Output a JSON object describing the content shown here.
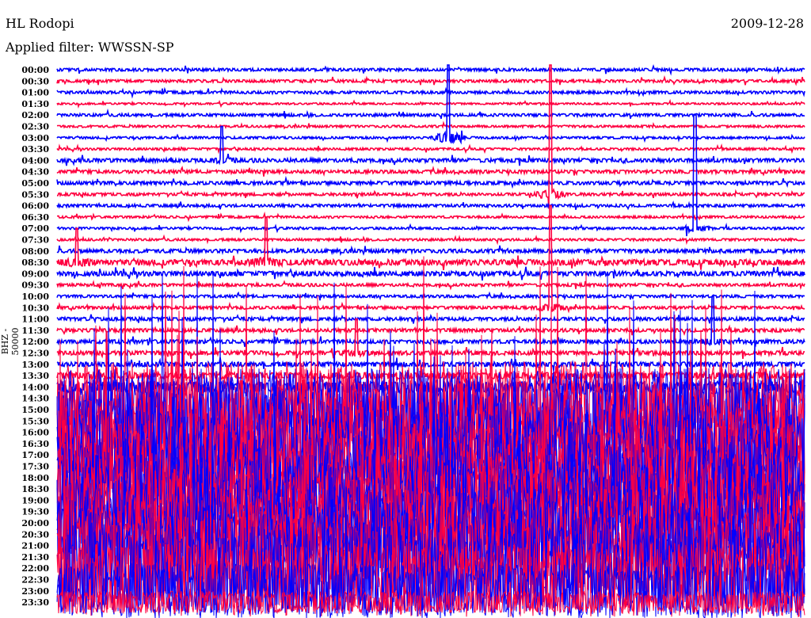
{
  "header": {
    "station": "HL Rodopi",
    "date": "2009-12-28",
    "filter": "Applied filter: WWSSN-SP"
  },
  "chart_data": {
    "type": "line",
    "title": "HL Rodopi",
    "subtitle": "Applied filter: WWSSN-SP",
    "ylabel": "BHZ - 50000",
    "xlabel": "",
    "row_minutes": 30,
    "colors": [
      "#0000ff",
      "#ff0040"
    ],
    "rows": [
      {
        "label": "00:00",
        "activity": 0.15
      },
      {
        "label": "00:30",
        "activity": 0.15
      },
      {
        "label": "01:00",
        "activity": 0.15
      },
      {
        "label": "01:30",
        "activity": 0.1
      },
      {
        "label": "02:00",
        "activity": 0.15
      },
      {
        "label": "02:30",
        "activity": 0.12
      },
      {
        "label": "03:00",
        "activity": 0.12
      },
      {
        "label": "03:30",
        "activity": 0.12
      },
      {
        "label": "04:00",
        "activity": 0.2
      },
      {
        "label": "04:30",
        "activity": 0.18
      },
      {
        "label": "05:00",
        "activity": 0.18
      },
      {
        "label": "05:30",
        "activity": 0.15
      },
      {
        "label": "06:00",
        "activity": 0.15
      },
      {
        "label": "06:30",
        "activity": 0.12
      },
      {
        "label": "07:00",
        "activity": 0.12
      },
      {
        "label": "07:30",
        "activity": 0.12
      },
      {
        "label": "08:00",
        "activity": 0.2
      },
      {
        "label": "08:30",
        "activity": 0.3
      },
      {
        "label": "09:00",
        "activity": 0.25
      },
      {
        "label": "09:30",
        "activity": 0.15
      },
      {
        "label": "10:00",
        "activity": 0.15
      },
      {
        "label": "10:30",
        "activity": 0.15
      },
      {
        "label": "11:00",
        "activity": 0.18
      },
      {
        "label": "11:30",
        "activity": 0.18
      },
      {
        "label": "12:00",
        "activity": 0.2
      },
      {
        "label": "12:30",
        "activity": 0.22
      },
      {
        "label": "13:00",
        "activity": 0.25
      },
      {
        "label": "13:30",
        "activity": 0.35
      },
      {
        "label": "14:00",
        "activity": 0.6
      },
      {
        "label": "14:30",
        "activity": 4
      },
      {
        "label": "15:00",
        "activity": 4.5
      },
      {
        "label": "15:30",
        "activity": 4.5
      },
      {
        "label": "16:00",
        "activity": 5
      },
      {
        "label": "16:30",
        "activity": 5
      },
      {
        "label": "17:00",
        "activity": 5
      },
      {
        "label": "17:30",
        "activity": 5
      },
      {
        "label": "18:00",
        "activity": 5
      },
      {
        "label": "18:30",
        "activity": 5
      },
      {
        "label": "19:00",
        "activity": 5
      },
      {
        "label": "19:30",
        "activity": 5
      },
      {
        "label": "20:00",
        "activity": 5
      },
      {
        "label": "20:30",
        "activity": 5
      },
      {
        "label": "21:00",
        "activity": 5
      },
      {
        "label": "21:30",
        "activity": 5
      },
      {
        "label": "22:00",
        "activity": 5
      },
      {
        "label": "22:30",
        "activity": 4
      },
      {
        "label": "23:00",
        "activity": 3
      },
      {
        "label": "23:30",
        "activity": 1.2
      }
    ],
    "events": [
      {
        "row": 6,
        "minute": 15.7,
        "amplitude": 20
      },
      {
        "row": 8,
        "minute": 6.6,
        "amplitude": 3
      },
      {
        "row": 17,
        "minute": 8.4,
        "amplitude": 4
      },
      {
        "row": 17,
        "minute": 0.8,
        "amplitude": 3
      },
      {
        "row": 11,
        "minute": 19.8,
        "amplitude": 12
      },
      {
        "row": 14,
        "minute": 25.6,
        "amplitude": 10
      },
      {
        "row": 21,
        "minute": 19.8,
        "amplitude": 9
      },
      {
        "row": 24,
        "minute": 26.3,
        "amplitude": 4
      },
      {
        "row": 25,
        "minute": 12.0,
        "amplitude": 3
      }
    ]
  }
}
